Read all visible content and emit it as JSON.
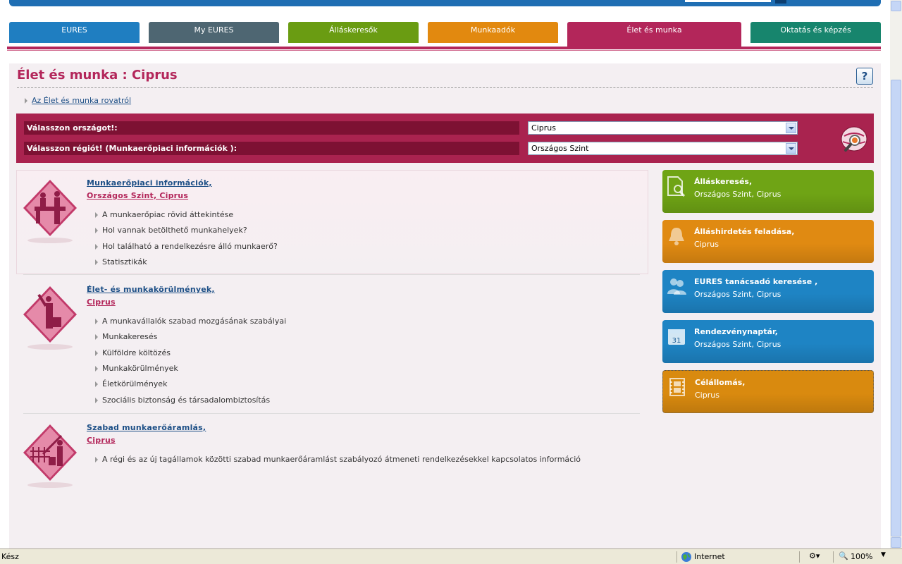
{
  "tabs": [
    {
      "label": "EURES",
      "color": "#1f7ec1",
      "active": false
    },
    {
      "label": "My EURES",
      "color": "#4e6672",
      "active": false
    },
    {
      "label": "Álláskeresők",
      "color": "#6a9c12",
      "active": false
    },
    {
      "label": "Munkaadók",
      "color": "#e2890f",
      "active": false
    },
    {
      "label": "Élet és munka",
      "color": "#b3265a",
      "active": true
    },
    {
      "label": "Oktatás és képzés",
      "color": "#17856d",
      "active": false
    }
  ],
  "page": {
    "title": "Élet és munka : Ciprus",
    "help_label": "?",
    "about_link": "Az Élet és munka rovatról"
  },
  "selector": {
    "country_label": "Válasszon országot!:",
    "country_value": "Ciprus",
    "region_label": "Válasszon régiót! (Munkaerőpiaci információk ):",
    "region_value": "Országos Szint"
  },
  "sections": [
    {
      "title": "Munkaerőpiaci információk,",
      "subtitle": "Országos Szint, Ciprus",
      "items": [
        "A munkaerőpiac rövid áttekintése",
        "Hol vannak betölthető munkahelyek?",
        "Hol található a rendelkezésre álló munkaerő?",
        "Statisztikák"
      ]
    },
    {
      "title": "Élet- és munkakörülmények,",
      "subtitle": "Ciprus",
      "items": [
        "A munkavállalók szabad mozgásának szabályai",
        "Munkakeresés",
        "Külföldre költözés",
        "Munkakörülmények",
        "Életkörülmények",
        "Szociális biztonság és társadalombiztosítás"
      ]
    },
    {
      "title": "Szabad munkaerőáramlás,",
      "subtitle": "Ciprus",
      "items": [
        "A régi és az új tagállamok közötti szabad munkaerőáramlást szabályozó átmeneti rendelkezésekkel kapcsolatos információ"
      ]
    }
  ],
  "quick_links": [
    {
      "title": "Álláskeresés,",
      "subtitle": "Országos Szint, Ciprus",
      "color": "#6fa415",
      "icon": "document-search-icon"
    },
    {
      "title": "Álláshirdetés feladása,",
      "subtitle": "Ciprus",
      "color": "#e08a12",
      "icon": "bell-icon"
    },
    {
      "title": "EURES tanácsadó keresése ,",
      "subtitle": "Országos Szint, Ciprus",
      "color": "#1e84c4",
      "icon": "people-icon"
    },
    {
      "title": "Rendezvénynaptár,",
      "subtitle": "Országos Szint, Ciprus",
      "color": "#1e84c4",
      "icon": "calendar-icon"
    },
    {
      "title": "Célállomás,",
      "subtitle": "Ciprus",
      "color": "#d98a0f",
      "icon": "film-icon"
    }
  ],
  "statusbar": {
    "status": "Kész",
    "zone": "Internet",
    "zoom": "100%"
  }
}
